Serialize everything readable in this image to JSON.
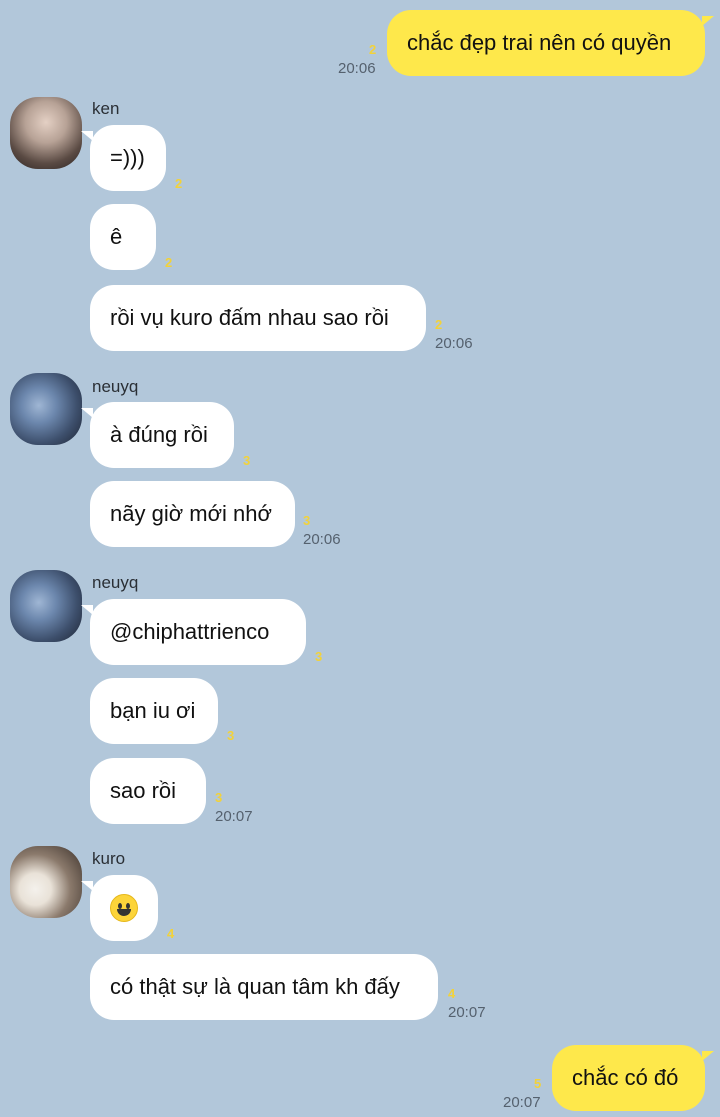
{
  "messages": {
    "m1": {
      "text": "chắc đẹp trai nên có quyền",
      "unread": "2",
      "time": "20:06"
    },
    "g1": {
      "sender": "ken",
      "avatar_icon": "ken-avatar",
      "m1": {
        "text": "=)))",
        "unread": "2"
      },
      "m2": {
        "text": "ê",
        "unread": "2"
      },
      "m3": {
        "text": "rồi vụ kuro đấm nhau sao rồi",
        "unread": "2",
        "time": "20:06"
      }
    },
    "g2": {
      "sender": "neuyq",
      "avatar_icon": "neuyq-avatar",
      "m1": {
        "text": "à đúng rồi",
        "unread": "3"
      },
      "m2": {
        "text": "nãy giờ mới nhớ",
        "unread": "3",
        "time": "20:06"
      }
    },
    "g3": {
      "sender": "neuyq",
      "avatar_icon": "neuyq-avatar",
      "m1": {
        "text": "@chiphattrienco",
        "unread": "3"
      },
      "m2": {
        "text": "bạn iu ơi",
        "unread": "3"
      },
      "m3": {
        "text": "sao rồi",
        "unread": "3",
        "time": "20:07"
      }
    },
    "g4": {
      "sender": "kuro",
      "avatar_icon": "kuro-avatar",
      "m1": {
        "emoji": "grinning-face-emoji",
        "unread": "4"
      },
      "m2": {
        "text": "có thật sự là quan tâm kh đấy",
        "unread": "4",
        "time": "20:07"
      }
    },
    "m2": {
      "text": "chắc có đó",
      "unread": "5",
      "time": "20:07"
    }
  },
  "colors": {
    "background": "#b2c7da",
    "outgoing_bubble": "#fee84b",
    "incoming_bubble": "#ffffff",
    "unread_count": "#f2d23a"
  }
}
